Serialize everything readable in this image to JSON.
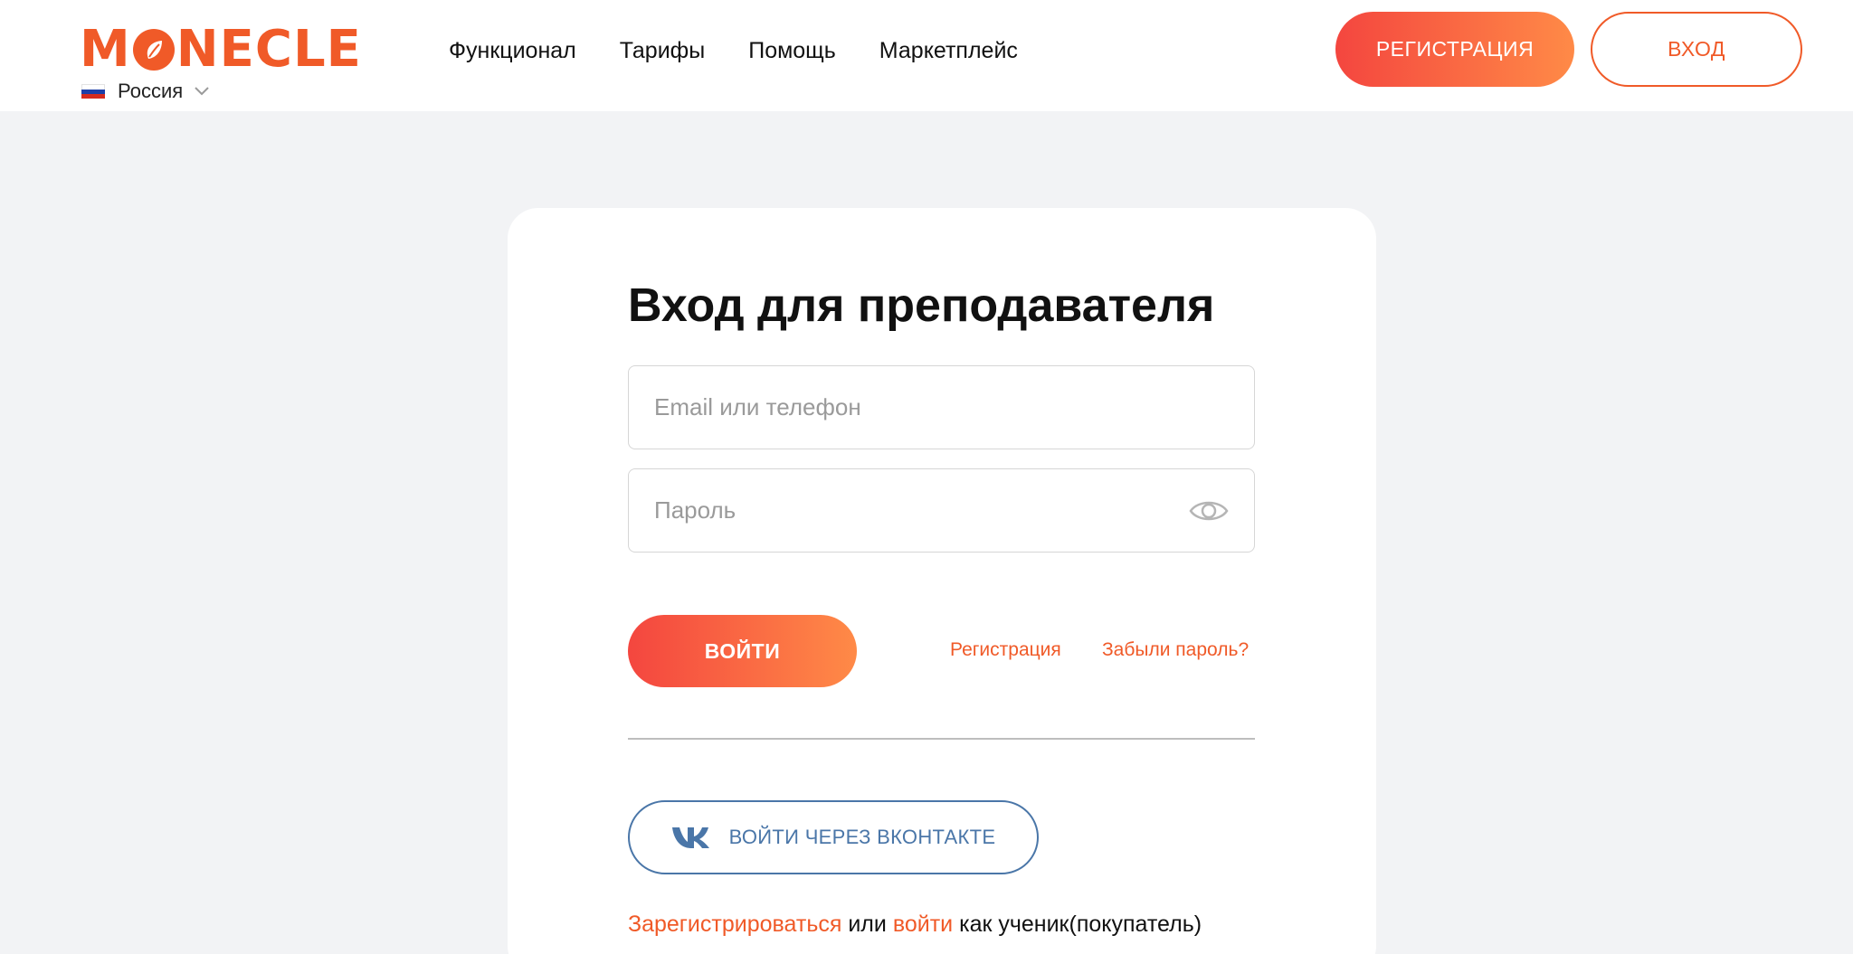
{
  "header": {
    "logo_before": "M",
    "logo_after": "NECLE",
    "region": "Россия",
    "nav": [
      "Функционал",
      "Тарифы",
      "Помощь",
      "Маркетплейс"
    ],
    "register_label": "РЕГИСТРАЦИЯ",
    "login_label": "ВХОД"
  },
  "form": {
    "title": "Вход для преподавателя",
    "email_placeholder": "Email или телефон",
    "email_value": "",
    "password_placeholder": "Пароль",
    "password_value": "",
    "submit_label": "ВОЙТИ",
    "register_link": "Регистрация",
    "forgot_link": "Забыли пароль?",
    "vk_label": "ВОЙТИ ЧЕРЕЗ ВКОНТАКТЕ",
    "student": {
      "register_link": "Зарегистрироваться",
      "or_text": "или",
      "login_link": "войти",
      "suffix": "как ученик(покупатель)"
    }
  },
  "colors": {
    "accent": "#f05a28",
    "gradient_start": "#f4463f",
    "gradient_end": "#ff8a47",
    "vk": "#4a76a8",
    "background": "#f2f3f5"
  },
  "icons": [
    "russia-flag-icon",
    "chevron-down-icon",
    "eye-icon",
    "vk-icon",
    "leaf-icon"
  ]
}
